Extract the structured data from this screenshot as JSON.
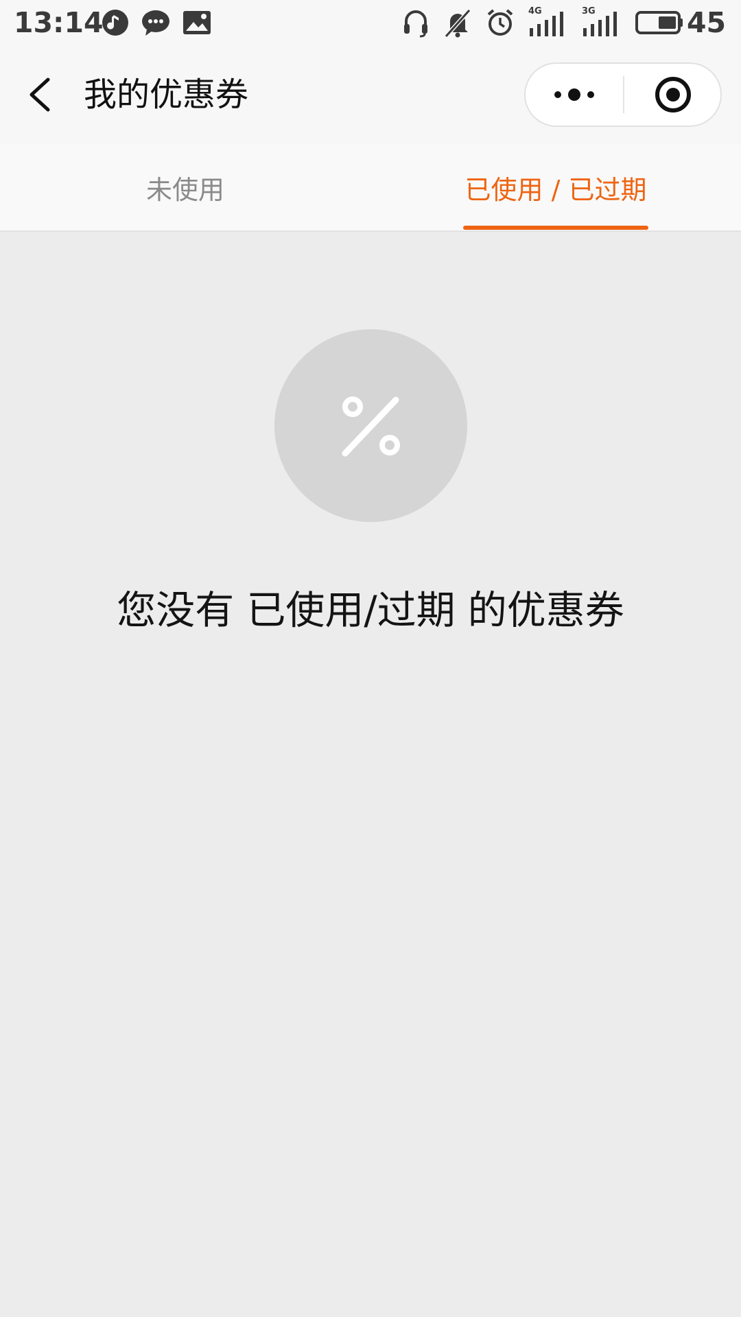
{
  "status_bar": {
    "time": "13:14",
    "battery_level": "45",
    "icons": [
      "music-icon",
      "chat-icon",
      "image-icon",
      "headset-icon",
      "bell-muted-icon",
      "alarm-icon",
      "signal-4g-icon",
      "signal-3g-icon",
      "battery-icon"
    ],
    "network_4g": "4G",
    "network_3g": "3G"
  },
  "nav": {
    "title": "我的优惠券",
    "back_icon": "chevron-left-icon",
    "more_icon": "more-dots-icon",
    "close_icon": "target-close-icon"
  },
  "tabs": [
    {
      "label": "未使用",
      "active": false
    },
    {
      "label": "已使用 / 已过期",
      "active": true
    }
  ],
  "empty_state": {
    "icon": "percent-icon",
    "message": "您没有 已使用/过期 的优惠券"
  },
  "colors": {
    "accent": "#ee6412",
    "page_bg": "#ececec",
    "bar_bg": "#f7f7f7",
    "circle_bg": "#d5d5d5"
  }
}
